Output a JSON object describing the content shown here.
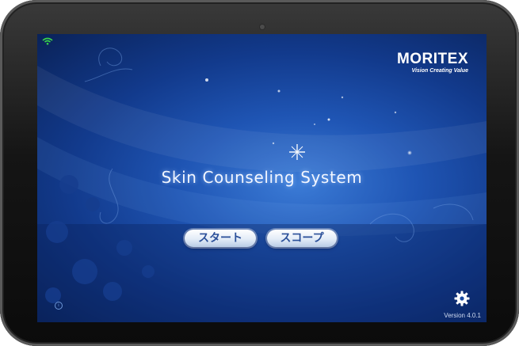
{
  "brand": {
    "name": "MORITEX",
    "tagline": "Vision Creating Value"
  },
  "app": {
    "title": "Skin Counseling System",
    "version": "Version 4.0.1"
  },
  "buttons": {
    "start_label": "スタート",
    "scope_label": "スコープ"
  },
  "icons": {
    "wifi": "wifi-icon",
    "info": "info-icon",
    "settings": "gear-icon"
  },
  "colors": {
    "background": "#1f55b4",
    "status_wifi": "#3ad24a",
    "button_text": "#2a4f99"
  }
}
